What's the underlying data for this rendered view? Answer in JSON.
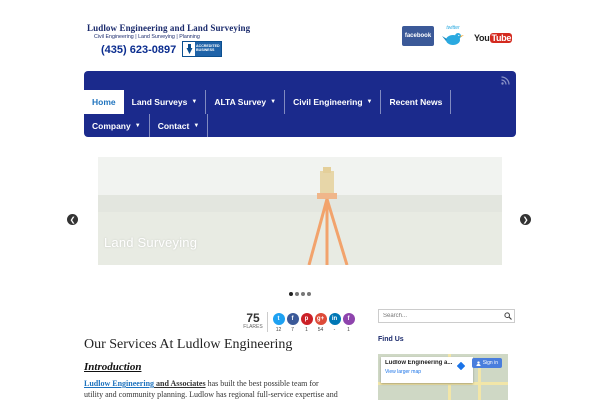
{
  "header": {
    "logo_title": "Ludlow Engineering and Land Surveying",
    "logo_tagline": "Civil Engineering | Land Surveying | Planning",
    "phone": "(435) 623-0897",
    "bbb_text": "ACCREDITED BUSINESS",
    "social": {
      "facebook_label": "facebook",
      "twitter_label": "twitter",
      "youtube_you": "You",
      "youtube_tube": "Tube"
    }
  },
  "nav": {
    "row1": [
      {
        "label": "Home",
        "active": true,
        "dropdown": false
      },
      {
        "label": "Land Surveys",
        "active": false,
        "dropdown": true
      },
      {
        "label": "ALTA Survey",
        "active": false,
        "dropdown": true
      },
      {
        "label": "Civil Engineering",
        "active": false,
        "dropdown": true
      },
      {
        "label": "Recent News",
        "active": false,
        "dropdown": false
      }
    ],
    "row2": [
      {
        "label": "Company",
        "active": false,
        "dropdown": true
      },
      {
        "label": "Contact",
        "active": false,
        "dropdown": true
      }
    ],
    "caret": "▼"
  },
  "slider": {
    "caption": "Land Surveying",
    "prev_glyph": "❮",
    "next_glyph": "❯",
    "dots": 4,
    "active_dot": 1
  },
  "share": {
    "total": "75",
    "total_label": "FLARES",
    "buttons": [
      {
        "network": "twitter",
        "glyph": "t",
        "count": "12",
        "color": "#1da1f2"
      },
      {
        "network": "facebook",
        "glyph": "f",
        "count": "7",
        "color": "#3b5998"
      },
      {
        "network": "pinterest",
        "glyph": "p",
        "count": "1",
        "color": "#cb2027"
      },
      {
        "network": "google-plus",
        "glyph": "g+",
        "count": "54",
        "color": "#dd4b39"
      },
      {
        "network": "linkedin",
        "glyph": "in",
        "count": "-",
        "color": "#0077b5"
      },
      {
        "network": "flare",
        "glyph": "f",
        "count": "1",
        "color": "#8e44ad"
      }
    ]
  },
  "article": {
    "title": "Our Services At Ludlow Engineering",
    "section": "Introduction",
    "link_text": "Ludlow Engineering",
    "strong_text": " and Associates",
    "line1_rest": " has built the best possible team for",
    "line2": "utility and community planning.  Ludlow has regional full-service expertise and"
  },
  "sidebar": {
    "search_placeholder": "Search...",
    "find_us": "Find Us",
    "map_place": "Ludlow Engineering a...",
    "map_link": "View larger map",
    "map_signin": "Sign in",
    "map_close": "×"
  }
}
